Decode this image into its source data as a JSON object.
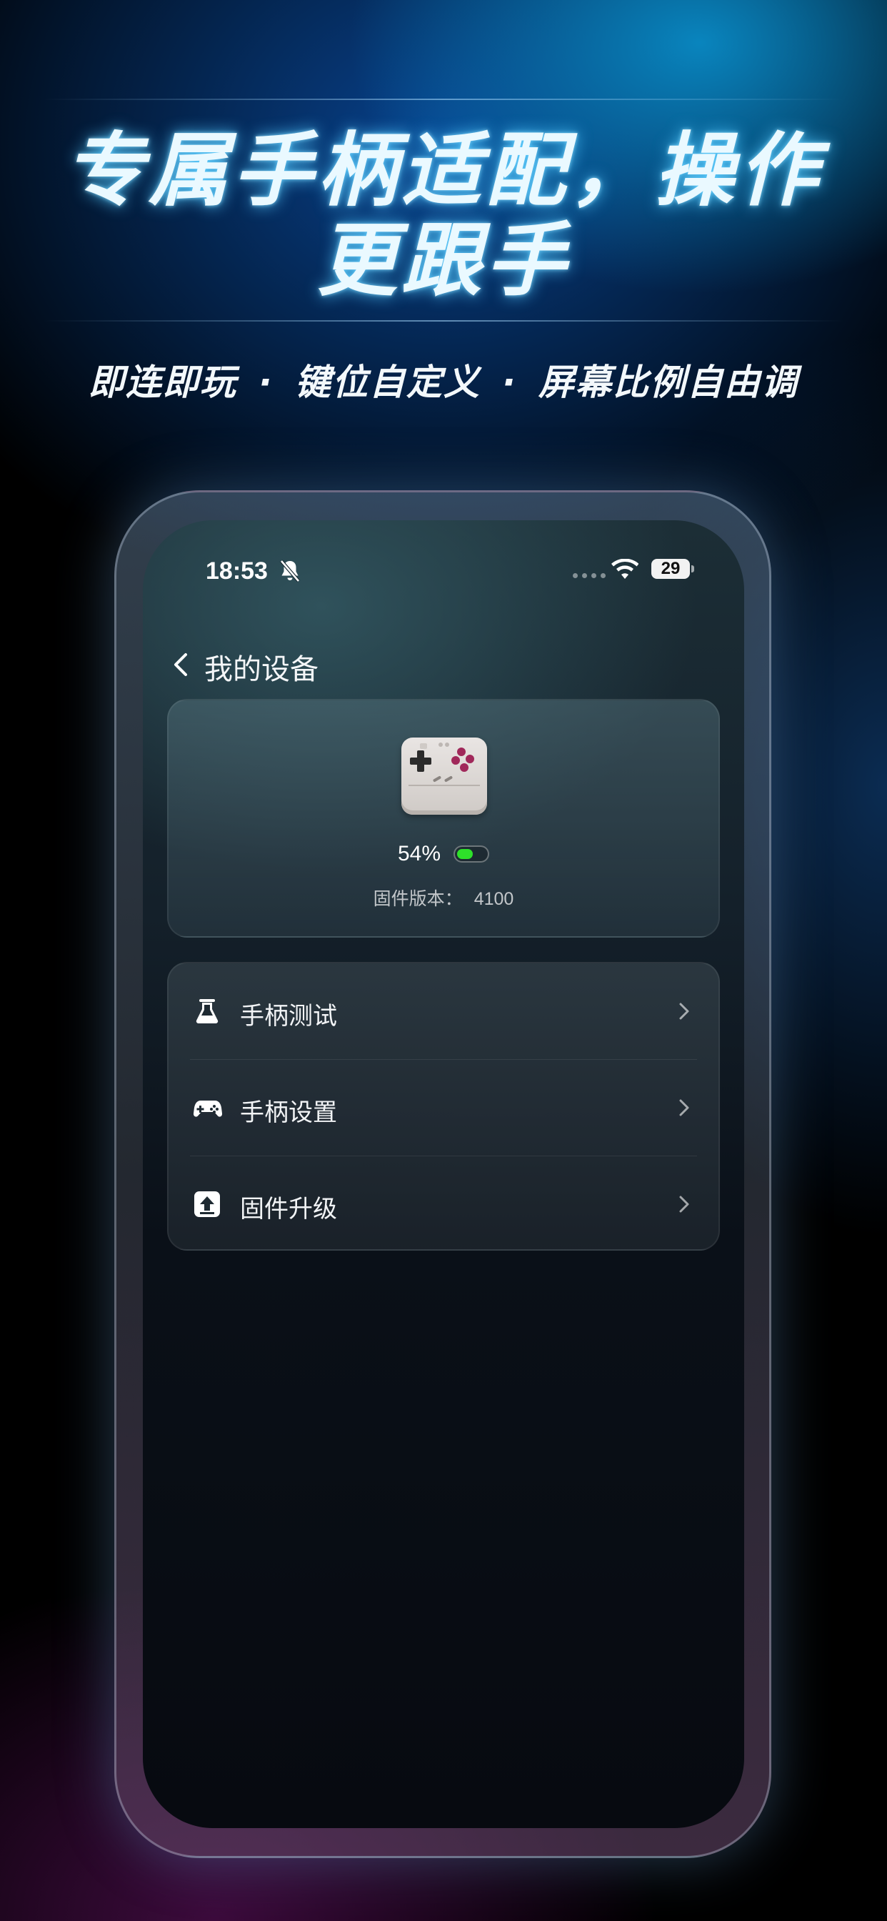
{
  "promo": {
    "headline_line1": "专属手柄适配，操作",
    "headline_line2": "更跟手",
    "features": [
      "即连即玩",
      "键位自定义",
      "屏幕比例自由调"
    ],
    "separator": "·"
  },
  "status_bar": {
    "time": "18:53",
    "battery_level": "29"
  },
  "nav": {
    "title": "我的设备"
  },
  "device": {
    "battery_percent": "54%",
    "battery_fraction": 0.54,
    "firmware_label": "固件版本：",
    "firmware_value": "4100"
  },
  "menu": {
    "items": [
      {
        "label": "手柄测试",
        "icon": "flask-icon"
      },
      {
        "label": "手柄设置",
        "icon": "gamepad-icon"
      },
      {
        "label": "固件升级",
        "icon": "upload-icon"
      }
    ]
  },
  "colors": {
    "battery_green": "#2ee02a",
    "headline_glow": "#50c8ff"
  }
}
